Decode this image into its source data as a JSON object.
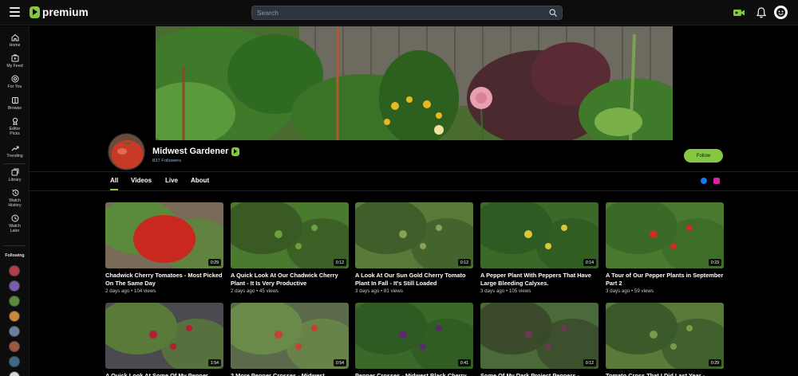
{
  "header": {
    "brand": "premium",
    "search_placeholder": "Search"
  },
  "sidebar": {
    "items": [
      {
        "label": "Home",
        "icon": "home-icon"
      },
      {
        "label": "My Feed",
        "icon": "feed-icon"
      },
      {
        "label": "For You",
        "icon": "for-you-icon"
      },
      {
        "label": "Browse",
        "icon": "browse-icon"
      },
      {
        "label1": "Editor",
        "label2": "Picks",
        "icon": "award-icon"
      },
      {
        "label": "Trending",
        "icon": "trending-icon"
      },
      {
        "label": "Library",
        "icon": "library-icon"
      },
      {
        "label1": "Watch",
        "label2": "History",
        "icon": "history-icon"
      },
      {
        "label1": "Watch",
        "label2": "Later",
        "icon": "clock-icon"
      }
    ],
    "following_label": "Following",
    "following_colors": [
      "#b83a4a",
      "#7c5bb5",
      "#5a8a3a",
      "#c98a3d",
      "#6a7fa0",
      "#a0583a",
      "#3d6a8a",
      "#d8d8d8"
    ]
  },
  "channel": {
    "name": "Midwest Gardener",
    "followers": "837 Followers",
    "follow_label": "Follow"
  },
  "tabs": [
    "All",
    "Videos",
    "Live",
    "About"
  ],
  "colors": {
    "accent": "#85c742",
    "facebook": "#1877f2",
    "instagram": "#d6249f"
  },
  "videos": [
    {
      "title": "Chadwick Cherry Tomatoes - Most Picked On The Same Day",
      "meta": "2 days ago • 104 views",
      "duration": "0:29"
    },
    {
      "title": "A Quick Look At Our Chadwick Cherry Plant - It Is Very Productive",
      "meta": "2 days ago • 45 views",
      "duration": "0:12"
    },
    {
      "title": "A Look At Our Sun Gold Cherry Tomato Plant In Fall - It's Still Loaded",
      "meta": "3 days ago • 81 views",
      "duration": "0:12"
    },
    {
      "title": "A Pepper Plant With Peppers That Have Large Bleeding Calyxes.",
      "meta": "3 days ago • 105 views",
      "duration": "0:14"
    },
    {
      "title": "A Tour of Our Pepper Plants in September Part 2",
      "meta": "3 days ago • 59 views",
      "duration": "0:23"
    },
    {
      "title": "A Quick Look At Some Of My Pepper",
      "meta": "",
      "duration": "1:54"
    },
    {
      "title": "2 More Pepper Crosses - Midwest",
      "meta": "",
      "duration": "0:54"
    },
    {
      "title": "Pepper Crosses - Midwest Black Cherry",
      "meta": "",
      "duration": "0:41"
    },
    {
      "title": "Some Of My Dark Project Peppers -",
      "meta": "",
      "duration": "0:12"
    },
    {
      "title": "Tomato Cross That I Did Last Year -",
      "meta": "",
      "duration": "0:29"
    }
  ]
}
